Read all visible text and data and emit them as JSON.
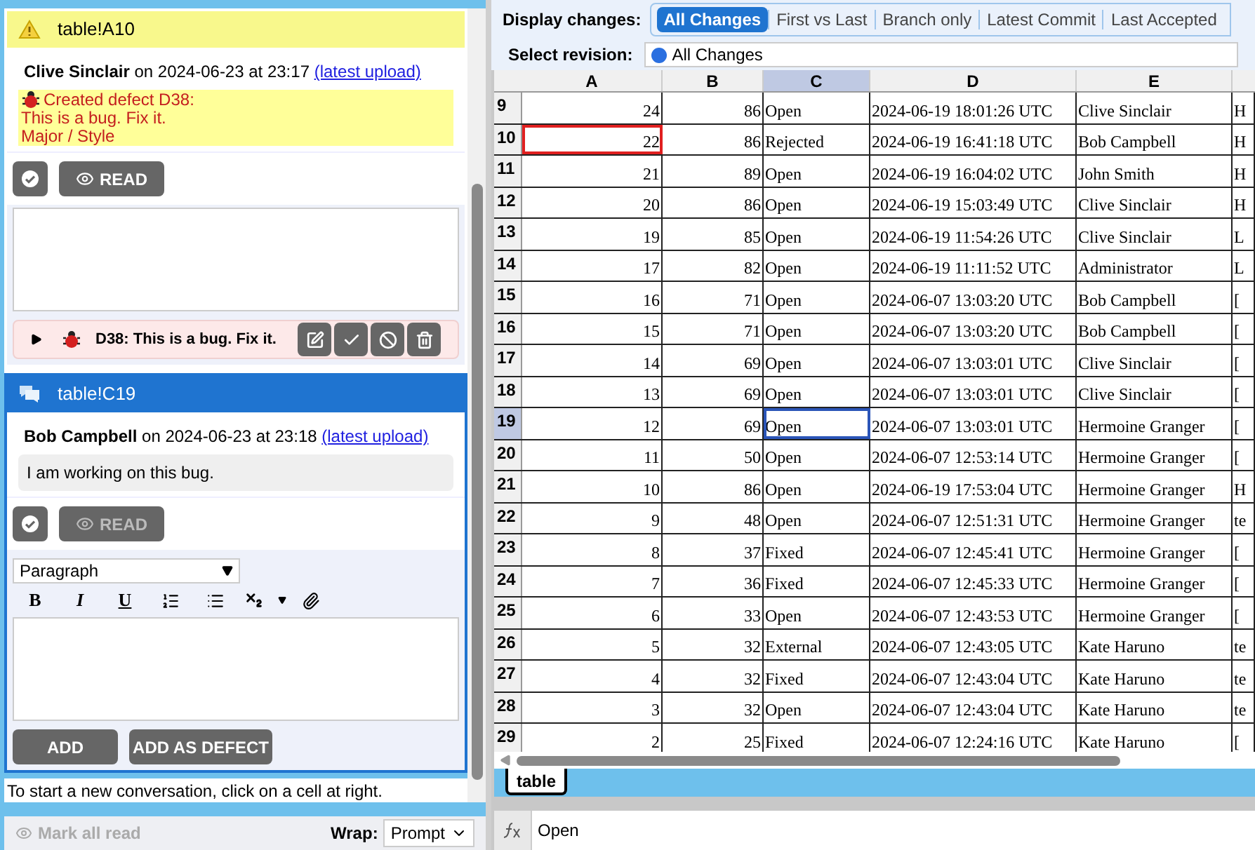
{
  "display_changes": {
    "label": "Display changes:",
    "tabs": [
      {
        "label": "All Changes",
        "selected": true
      },
      {
        "label": "First vs Last",
        "selected": false
      },
      {
        "label": "Branch only",
        "selected": false
      },
      {
        "label": "Latest Commit",
        "selected": false
      },
      {
        "label": "Last Accepted",
        "selected": false
      }
    ]
  },
  "select_revision": {
    "label": "Select revision:",
    "value": "All Changes"
  },
  "conversations": [
    {
      "kind": "warning",
      "cell": "table!A10",
      "active": false,
      "message": {
        "author": "Clive Sinclair",
        "meta": "on 2024-06-23 at 23:17",
        "link": "(latest upload)",
        "kind": "defect",
        "lines": [
          "Created defect D38:",
          "This is a bug. Fix it.",
          "Major / Style"
        ]
      },
      "read_button": {
        "label": "READ",
        "disabled": false
      },
      "defect": {
        "title": "D38: This is a bug. Fix it.",
        "expanded": false
      }
    },
    {
      "kind": "comment",
      "cell": "table!C19",
      "active": true,
      "message": {
        "author": "Bob Campbell",
        "meta": "on 2024-06-23 at 23:18",
        "link": "(latest upload)",
        "kind": "comment",
        "lines": [
          "I am working on this bug."
        ]
      },
      "read_button": {
        "label": "READ",
        "disabled": true
      },
      "editor": {
        "block_format": "Paragraph",
        "text_buttons": [
          "B",
          "I",
          "U"
        ],
        "buttons": [
          "ADD",
          "ADD AS DEFECT"
        ]
      }
    }
  ],
  "hint": "To start a new conversation, click on a cell at right.",
  "footer": {
    "mark_all_read": {
      "label": "Mark all read",
      "disabled": true
    },
    "wrap_label": "Wrap:",
    "wrap_value": "Prompt"
  },
  "sheet": {
    "columns": [
      {
        "label": "A",
        "selected": false
      },
      {
        "label": "B",
        "selected": false
      },
      {
        "label": "C",
        "selected": true
      },
      {
        "label": "D",
        "selected": false
      },
      {
        "label": "E",
        "selected": false
      }
    ],
    "rows": [
      {
        "header": "9",
        "selected": false,
        "flagged": false,
        "cells": [
          "24",
          "86",
          "Open",
          "2024-06-19 18:01:26 UTC",
          "Clive Sinclair",
          "H"
        ]
      },
      {
        "header": "10",
        "selected": false,
        "flagged": true,
        "cells": [
          "22",
          "86",
          "Rejected",
          "2024-06-19 16:41:18 UTC",
          "Bob Campbell",
          "H"
        ]
      },
      {
        "header": "11",
        "selected": false,
        "flagged": false,
        "cells": [
          "21",
          "89",
          "Open",
          "2024-06-19 16:04:02 UTC",
          "John Smith",
          "H"
        ]
      },
      {
        "header": "12",
        "selected": false,
        "flagged": false,
        "cells": [
          "20",
          "86",
          "Open",
          "2024-06-19 15:03:49 UTC",
          "Clive Sinclair",
          "H"
        ]
      },
      {
        "header": "13",
        "selected": false,
        "flagged": false,
        "cells": [
          "19",
          "85",
          "Open",
          "2024-06-19 11:54:26 UTC",
          "Clive Sinclair",
          "L"
        ]
      },
      {
        "header": "14",
        "selected": false,
        "flagged": false,
        "cells": [
          "17",
          "82",
          "Open",
          "2024-06-19 11:11:52 UTC",
          "Administrator",
          "L"
        ]
      },
      {
        "header": "15",
        "selected": false,
        "flagged": false,
        "cells": [
          "16",
          "71",
          "Open",
          "2024-06-07 13:03:20 UTC",
          "Bob Campbell",
          "["
        ]
      },
      {
        "header": "16",
        "selected": false,
        "flagged": false,
        "cells": [
          "15",
          "71",
          "Open",
          "2024-06-07 13:03:20 UTC",
          "Bob Campbell",
          "["
        ]
      },
      {
        "header": "17",
        "selected": false,
        "flagged": false,
        "cells": [
          "14",
          "69",
          "Open",
          "2024-06-07 13:03:01 UTC",
          "Clive Sinclair",
          "["
        ]
      },
      {
        "header": "18",
        "selected": false,
        "flagged": false,
        "cells": [
          "13",
          "69",
          "Open",
          "2024-06-07 13:03:01 UTC",
          "Clive Sinclair",
          "["
        ]
      },
      {
        "header": "19",
        "selected": true,
        "flagged": false,
        "cells": [
          "12",
          "69",
          "Open",
          "2024-06-07 13:03:01 UTC",
          "Hermoine Granger",
          "["
        ]
      },
      {
        "header": "20",
        "selected": false,
        "flagged": false,
        "cells": [
          "11",
          "50",
          "Open",
          "2024-06-07 12:53:14 UTC",
          "Hermoine Granger",
          "["
        ]
      },
      {
        "header": "21",
        "selected": false,
        "flagged": false,
        "cells": [
          "10",
          "86",
          "Open",
          "2024-06-19 17:53:04 UTC",
          "Hermoine Granger",
          "H"
        ]
      },
      {
        "header": "22",
        "selected": false,
        "flagged": false,
        "cells": [
          "9",
          "48",
          "Open",
          "2024-06-07 12:51:31 UTC",
          "Hermoine Granger",
          "te"
        ]
      },
      {
        "header": "23",
        "selected": false,
        "flagged": false,
        "cells": [
          "8",
          "37",
          "Fixed",
          "2024-06-07 12:45:41 UTC",
          "Hermoine Granger",
          "["
        ]
      },
      {
        "header": "24",
        "selected": false,
        "flagged": false,
        "cells": [
          "7",
          "36",
          "Fixed",
          "2024-06-07 12:45:33 UTC",
          "Hermoine Granger",
          "["
        ]
      },
      {
        "header": "25",
        "selected": false,
        "flagged": false,
        "cells": [
          "6",
          "33",
          "Open",
          "2024-06-07 12:43:53 UTC",
          "Hermoine Granger",
          "["
        ]
      },
      {
        "header": "26",
        "selected": false,
        "flagged": false,
        "cells": [
          "5",
          "32",
          "External",
          "2024-06-07 12:43:05 UTC",
          "Kate Haruno",
          "te"
        ]
      },
      {
        "header": "27",
        "selected": false,
        "flagged": false,
        "cells": [
          "4",
          "32",
          "Fixed",
          "2024-06-07 12:43:04 UTC",
          "Kate Haruno",
          "te"
        ]
      },
      {
        "header": "28",
        "selected": false,
        "flagged": false,
        "cells": [
          "3",
          "32",
          "Open",
          "2024-06-07 12:43:04 UTC",
          "Kate Haruno",
          "te"
        ]
      },
      {
        "header": "29",
        "selected": false,
        "flagged": false,
        "cells": [
          "2",
          "25",
          "Fixed",
          "2024-06-07 12:24:16 UTC",
          "Kate Haruno",
          "["
        ]
      }
    ],
    "tabs": [
      {
        "label": "table",
        "selected": true
      }
    ],
    "formula": "Open"
  }
}
